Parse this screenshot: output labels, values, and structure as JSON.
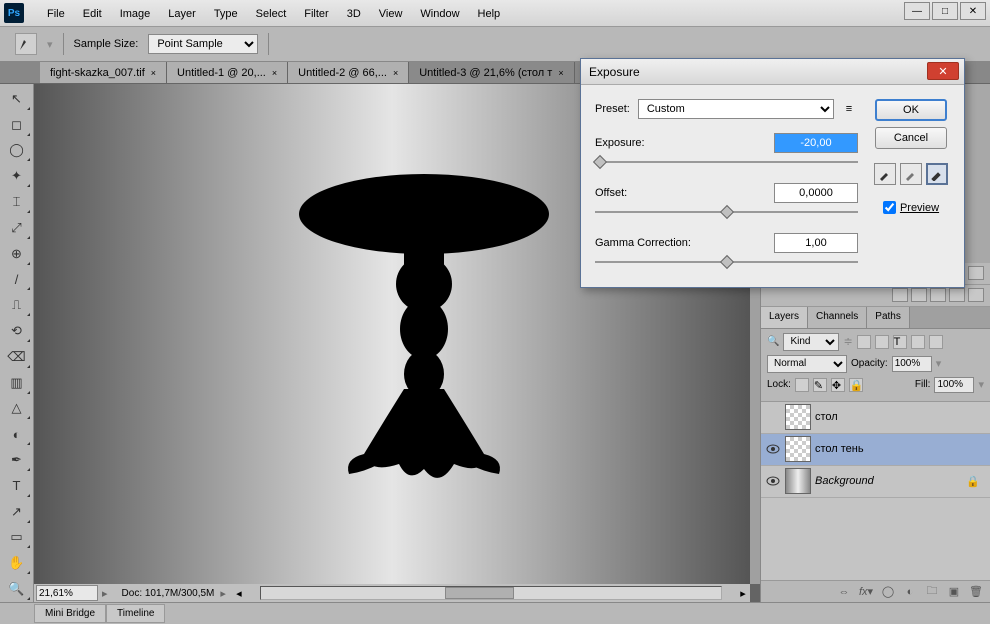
{
  "ps_logo": "Ps",
  "menubar": [
    "File",
    "Edit",
    "Image",
    "Layer",
    "Type",
    "Select",
    "Filter",
    "3D",
    "View",
    "Window",
    "Help"
  ],
  "options": {
    "sample_label": "Sample Size:",
    "sample_value": "Point Sample"
  },
  "tabs": [
    {
      "label": "fight-skazka_007.tif",
      "close": "×"
    },
    {
      "label": "Untitled-1 @ 20,...",
      "close": "×"
    },
    {
      "label": "Untitled-2 @ 66,...",
      "close": "×"
    },
    {
      "label": "Untitled-3 @ 21,6% (стол т",
      "close": "×",
      "active": true
    }
  ],
  "canvas": {
    "zoom": "21,61%",
    "doc_info": "Doc: 101,7M/300,5M"
  },
  "bottom_tabs": [
    "Mini Bridge",
    "Timeline"
  ],
  "panels": {
    "layer_tabs": [
      "Layers",
      "Channels",
      "Paths"
    ],
    "kind_val": "Kind",
    "blend_mode": "Normal",
    "opacity_label": "Opacity:",
    "opacity_val": "100%",
    "lock_label": "Lock:",
    "fill_label": "Fill:",
    "fill_val": "100%",
    "layers": [
      {
        "name": "стол",
        "visible": false,
        "transparent": true
      },
      {
        "name": "стол тень",
        "visible": true,
        "selected": true,
        "transparent": true
      },
      {
        "name": "Background",
        "visible": true,
        "italic": true,
        "locked": true,
        "gradient": true
      }
    ]
  },
  "dialog": {
    "title": "Exposure",
    "preset_label": "Preset:",
    "preset_value": "Custom",
    "exposure_label": "Exposure:",
    "exposure_value": "-20,00",
    "offset_label": "Offset:",
    "offset_value": "0,0000",
    "gamma_label": "Gamma Correction:",
    "gamma_value": "1,00",
    "ok": "OK",
    "cancel": "Cancel",
    "preview": "Preview"
  }
}
